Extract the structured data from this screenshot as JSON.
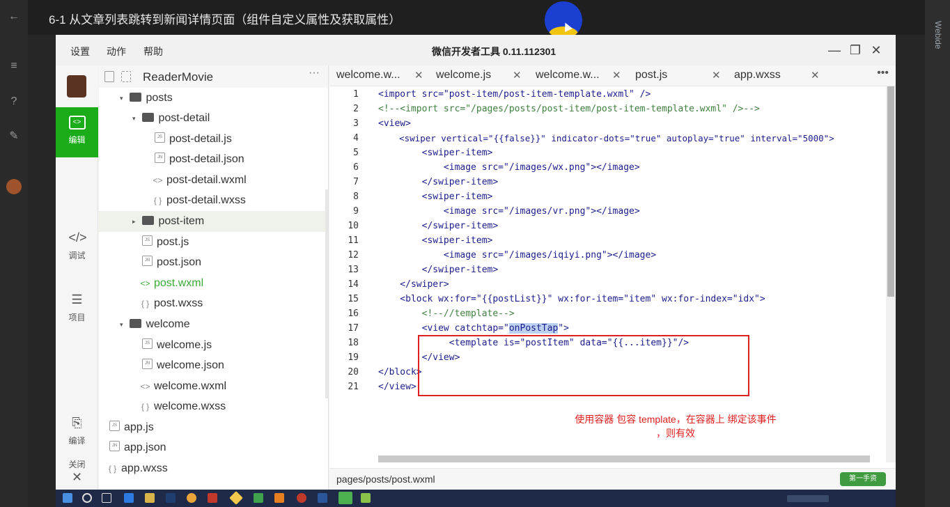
{
  "video": {
    "title": "6-1 从文章列表跳转到新闻详情页面（组件自定义属性及获取属性）",
    "right_label": "Webide"
  },
  "ide": {
    "menu": [
      "设置",
      "动作",
      "帮助"
    ],
    "title": "微信开发者工具 0.11.112301",
    "toolbar": [
      {
        "label": "编辑",
        "icon": "code-icon"
      },
      {
        "label": "调试",
        "icon": "debug-icon"
      },
      {
        "label": "项目",
        "icon": "list-icon"
      },
      {
        "label": "编译",
        "icon": "compile-icon"
      },
      {
        "label": "关闭",
        "icon": "close-icon"
      }
    ],
    "project_name": "ReaderMovie",
    "tree": [
      {
        "label": "posts",
        "kind": "folder",
        "arrow": "▾"
      },
      {
        "label": "post-detail",
        "kind": "folder",
        "arrow": "▾"
      },
      {
        "label": "post-detail.js",
        "kind": "js"
      },
      {
        "label": "post-detail.json",
        "kind": "json"
      },
      {
        "label": "post-detail.wxml",
        "kind": "wxml"
      },
      {
        "label": "post-detail.wxss",
        "kind": "wxss"
      },
      {
        "label": "post-item",
        "kind": "folder",
        "arrow": "▸"
      },
      {
        "label": "post.js",
        "kind": "js"
      },
      {
        "label": "post.json",
        "kind": "json"
      },
      {
        "label": "post.wxml",
        "kind": "wxml"
      },
      {
        "label": "post.wxss",
        "kind": "wxss"
      },
      {
        "label": "welcome",
        "kind": "folder",
        "arrow": "▾"
      },
      {
        "label": "welcome.js",
        "kind": "js"
      },
      {
        "label": "welcome.json",
        "kind": "json"
      },
      {
        "label": "welcome.wxml",
        "kind": "wxml"
      },
      {
        "label": "welcome.wxss",
        "kind": "wxss"
      },
      {
        "label": "app.js",
        "kind": "js"
      },
      {
        "label": "app.json",
        "kind": "json"
      },
      {
        "label": "app.wxss",
        "kind": "wxss"
      }
    ],
    "tabs": [
      "welcome.w...",
      "welcome.js",
      "welcome.w...",
      "post.js",
      "app.wxss"
    ],
    "status_path": "pages/posts/post.wxml",
    "annotation_line1": "使用容器 包容 template，在容器上 绑定该事件",
    "annotation_line2": "，则有效",
    "code": {
      "l1": "<import src=\"post-item/post-item-template.wxml\" />",
      "l2": "<!--<import src=\"/pages/posts/post-item/post-item-template.wxml\" />-->",
      "l3": "<view>",
      "l4": "    <swiper vertical=\"{{false}}\" indicator-dots=\"true\" autoplay=\"true\" interval=\"5000\">",
      "l5": "        <swiper-item>",
      "l6": "            <image src=\"/images/wx.png\"></image>",
      "l7": "        </swiper-item>",
      "l8": "        <swiper-item>",
      "l9": "            <image src=\"/images/vr.png\"></image>",
      "l10": "        </swiper-item>",
      "l11": "        <swiper-item>",
      "l12": "            <image src=\"/images/iqiyi.png\"></image>",
      "l13": "        </swiper-item>",
      "l14": "    </swiper>",
      "l15": "    <block wx:for=\"{{postList}}\" wx:for-item=\"item\" wx:for-index=\"idx\">",
      "l16": "        <!--//template-->",
      "l17a": "        <view catchtap=\"",
      "l17b": "onPostTap",
      "l17c": "\">",
      "l18": "             <template is=\"postItem\" data=\"{{...item}}\"/>",
      "l19": "        </view>",
      "l20": "</block>",
      "l21": "</view>"
    },
    "badge": "第一手资"
  },
  "colors": {
    "accent_green": "#1aad19",
    "annotation_red": "#e02020"
  }
}
